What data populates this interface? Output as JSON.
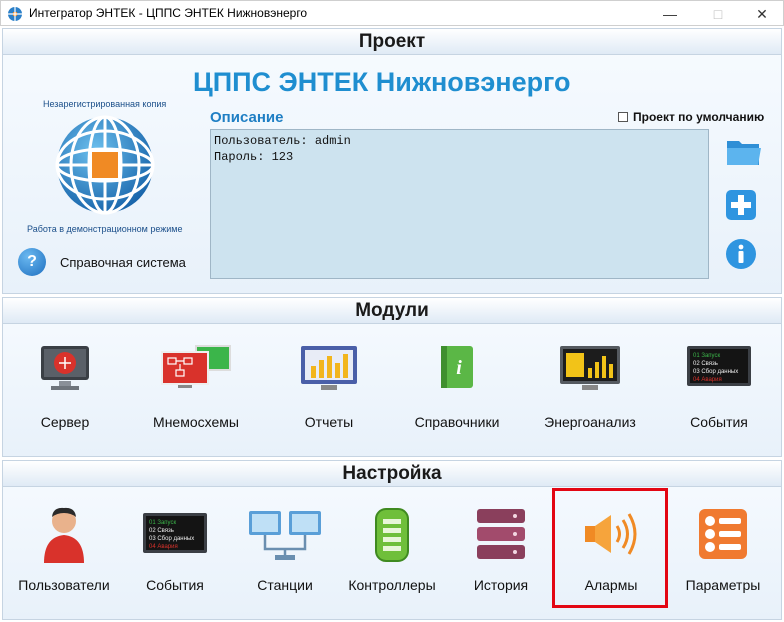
{
  "window": {
    "title": "Интегратор ЭНТЕК - ЦППС ЭНТЕК Нижновэнерго"
  },
  "project": {
    "header": "Проект",
    "name": "ЦППС ЭНТЕК Нижновэнерго",
    "unregistered": "Незарегистрированная копия",
    "demo_mode": "Работа в демонстрационном режиме",
    "help_label": "Справочная система",
    "description_label": "Описание",
    "default_project_label": "Проект по умолчанию",
    "default_project_checked": false,
    "description_text": "Пользователь: admin\nПароль: 123"
  },
  "modules": {
    "header": "Модули",
    "items": [
      {
        "label": "Сервер",
        "icon": "server-icon"
      },
      {
        "label": "Мнемосхемы",
        "icon": "mnemonic-icon"
      },
      {
        "label": "Отчеты",
        "icon": "reports-icon"
      },
      {
        "label": "Справочники",
        "icon": "reference-icon"
      },
      {
        "label": "Энергоанализ",
        "icon": "energy-analysis-icon"
      },
      {
        "label": "События",
        "icon": "events-icon"
      }
    ]
  },
  "settings": {
    "header": "Настройка",
    "items": [
      {
        "label": "Пользователи",
        "icon": "user-icon"
      },
      {
        "label": "События",
        "icon": "events-icon"
      },
      {
        "label": "Станции",
        "icon": "stations-icon"
      },
      {
        "label": "Контроллеры",
        "icon": "controllers-icon"
      },
      {
        "label": "История",
        "icon": "history-icon"
      },
      {
        "label": "Алармы",
        "icon": "alarm-speaker-icon"
      },
      {
        "label": "Параметры",
        "icon": "parameters-icon"
      }
    ],
    "highlighted": "Алармы",
    "highlight_color": "#e30613"
  },
  "events_icon_text": [
    "01 Запуск",
    "02 Связь",
    "03 Сбор данных",
    "04 Авария"
  ],
  "colors": {
    "brand": "#1f8ed0",
    "accent": "#1f7fc4"
  }
}
